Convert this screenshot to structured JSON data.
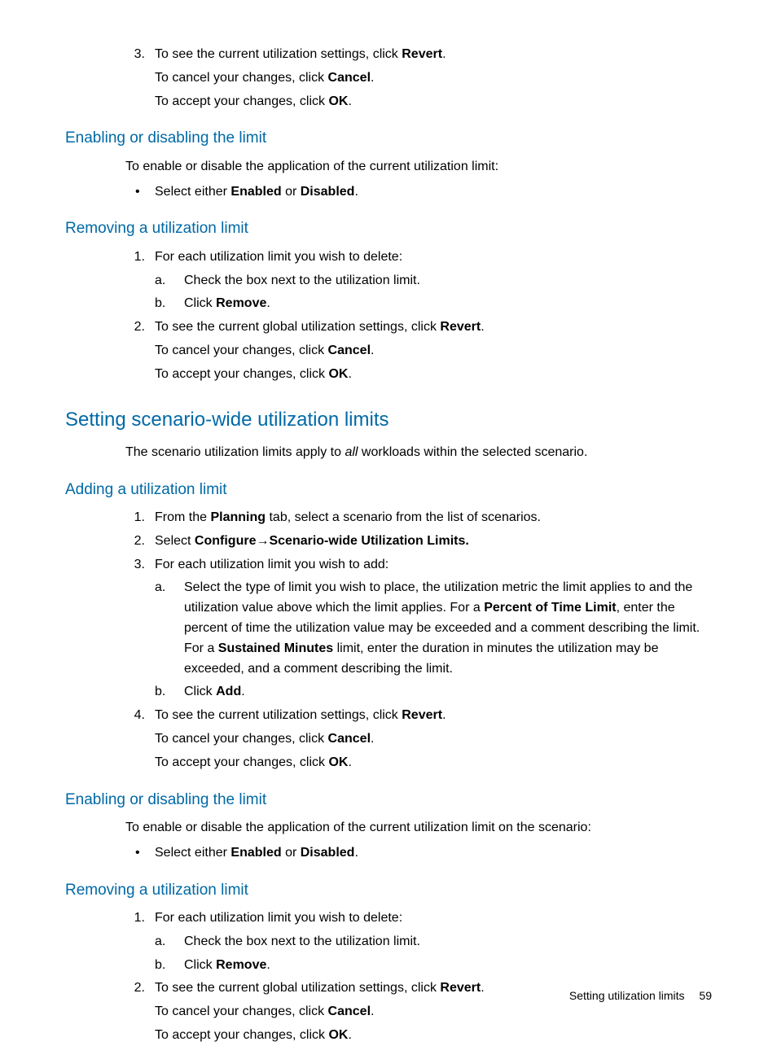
{
  "top_section": {
    "item3": {
      "num": "3.",
      "line1_a": "To see the current utilization settings, click ",
      "line1_b": "Revert",
      "line1_c": ".",
      "line2_a": "To cancel your changes, click ",
      "line2_b": "Cancel",
      "line2_c": ".",
      "line3_a": "To accept your changes, click ",
      "line3_b": "OK",
      "line3_c": "."
    }
  },
  "enable1": {
    "heading": "Enabling or disabling the limit",
    "intro": "To enable or disable the application of the current utilization limit:",
    "bullet_a": "Select either ",
    "bullet_b": "Enabled",
    "bullet_c": " or ",
    "bullet_d": "Disabled",
    "bullet_e": "."
  },
  "remove1": {
    "heading": "Removing a utilization limit",
    "item1": {
      "num": "1.",
      "text": "For each utilization limit you wish to delete:",
      "a": "Check the box next to the utilization limit.",
      "b_a": "Click ",
      "b_b": "Remove",
      "b_c": "."
    },
    "item2": {
      "num": "2.",
      "line1_a": "To see the current global utilization settings, click ",
      "line1_b": "Revert",
      "line1_c": ".",
      "line2_a": "To cancel your changes, click ",
      "line2_b": "Cancel",
      "line2_c": ".",
      "line3_a": "To accept your changes, click ",
      "line3_b": "OK",
      "line3_c": "."
    }
  },
  "scenario": {
    "heading": "Setting scenario-wide utilization limits",
    "intro_a": "The scenario utilization limits apply to ",
    "intro_b": "all",
    "intro_c": " workloads within the selected scenario."
  },
  "adding": {
    "heading": "Adding a utilization limit",
    "item1": {
      "num": "1.",
      "a": "From the ",
      "b": "Planning",
      "c": " tab, select a scenario from the list of scenarios."
    },
    "item2": {
      "num": "2.",
      "a": "Select ",
      "b": "Configure",
      "arrow": "→",
      "c": "Scenario-wide Utilization Limits."
    },
    "item3": {
      "num": "3.",
      "text": "For each utilization limit you wish to add:",
      "a_1": "Select the type of limit you wish to place, the utilization metric the limit applies to and the utilization value above which the limit applies. For a ",
      "a_2": "Percent of Time Limit",
      "a_3": ", enter the percent of time the utilization value may be exceeded and a comment describing the limit. For a ",
      "a_4": "Sustained Minutes",
      "a_5": " limit, enter the duration in minutes the utilization may be exceeded, and a comment describing the limit.",
      "b_a": "Click ",
      "b_b": "Add",
      "b_c": "."
    },
    "item4": {
      "num": "4.",
      "line1_a": "To see the current utilization settings, click ",
      "line1_b": "Revert",
      "line1_c": ".",
      "line2_a": "To cancel your changes, click ",
      "line2_b": "Cancel",
      "line2_c": ".",
      "line3_a": "To accept your changes, click ",
      "line3_b": "OK",
      "line3_c": "."
    }
  },
  "enable2": {
    "heading": "Enabling or disabling the limit",
    "intro": "To enable or disable the application of the current utilization limit on the scenario:",
    "bullet_a": "Select either ",
    "bullet_b": "Enabled",
    "bullet_c": " or ",
    "bullet_d": "Disabled",
    "bullet_e": "."
  },
  "remove2": {
    "heading": "Removing a utilization limit",
    "item1": {
      "num": "1.",
      "text": "For each utilization limit you wish to delete:",
      "a": "Check the box next to the utilization limit.",
      "b_a": "Click ",
      "b_b": "Remove",
      "b_c": "."
    },
    "item2": {
      "num": "2.",
      "line1_a": "To see the current global utilization settings, click ",
      "line1_b": "Revert",
      "line1_c": ".",
      "line2_a": "To cancel your changes, click ",
      "line2_b": "Cancel",
      "line2_c": ".",
      "line3_a": "To accept your changes, click ",
      "line3_b": "OK",
      "line3_c": "."
    }
  },
  "footer": {
    "title": "Setting utilization limits",
    "page": "59"
  }
}
